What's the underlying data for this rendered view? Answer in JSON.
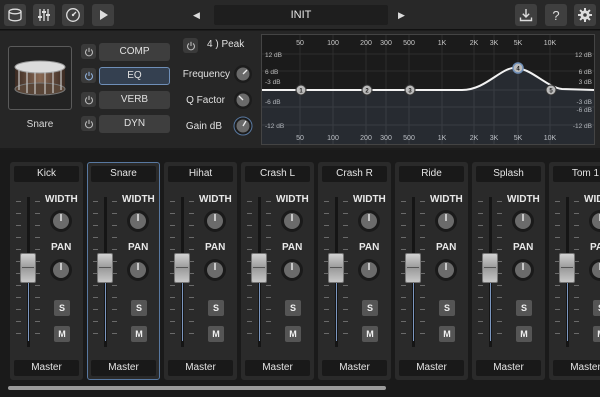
{
  "topbar": {
    "icons": [
      "drum-kit-icon",
      "mixer-sliders-icon",
      "gauge-icon",
      "play-icon",
      "export-icon",
      "help-icon",
      "gear-icon"
    ],
    "help_label": "?",
    "preset": {
      "name": "INIT",
      "prev_symbol": "◀",
      "next_symbol": "▶"
    }
  },
  "instrument": {
    "name": "Snare",
    "icon": "snare-drum-image"
  },
  "fx_buttons": [
    {
      "label": "COMP",
      "active": false
    },
    {
      "label": "EQ",
      "active": true
    },
    {
      "label": "VERB",
      "active": false
    },
    {
      "label": "DYN",
      "active": false
    }
  ],
  "eq": {
    "band_title": "4 ) Peak",
    "params": [
      "Frequency",
      "Q Factor",
      "Gain dB"
    ],
    "freq_labels": [
      "50",
      "100",
      "200",
      "300",
      "500",
      "1K",
      "2K",
      "3K",
      "5K",
      "10K"
    ],
    "db_labels_left": [
      "12 dB",
      "6 dB",
      "-3 dB",
      "-6 dB",
      "-12 dB"
    ],
    "db_labels_right": [
      "12 dB",
      "6 dB",
      "3 dB",
      "-3 dB",
      "-6 dB",
      "-12 dB"
    ],
    "nodes": [
      "1",
      "2",
      "3",
      "4",
      "5"
    ]
  },
  "mixer": {
    "width_label": "WIDTH",
    "pan_label": "PAN",
    "solo_label": "S",
    "mute_label": "M",
    "channels": [
      {
        "name": "Kick",
        "output": "Master",
        "selected": false
      },
      {
        "name": "Snare",
        "output": "Master",
        "selected": true
      },
      {
        "name": "Hihat",
        "output": "Master",
        "selected": false
      },
      {
        "name": "Crash L",
        "output": "Master",
        "selected": false
      },
      {
        "name": "Crash R",
        "output": "Master",
        "selected": false
      },
      {
        "name": "Ride",
        "output": "Master",
        "selected": false
      },
      {
        "name": "Splash",
        "output": "Master",
        "selected": false
      },
      {
        "name": "Tom 1",
        "output": "Master",
        "selected": false
      }
    ]
  },
  "colors": {
    "accent": "#7c97c0",
    "eq_curve": "#f2f2f2",
    "active_band_fill": "#6f8fb8"
  }
}
